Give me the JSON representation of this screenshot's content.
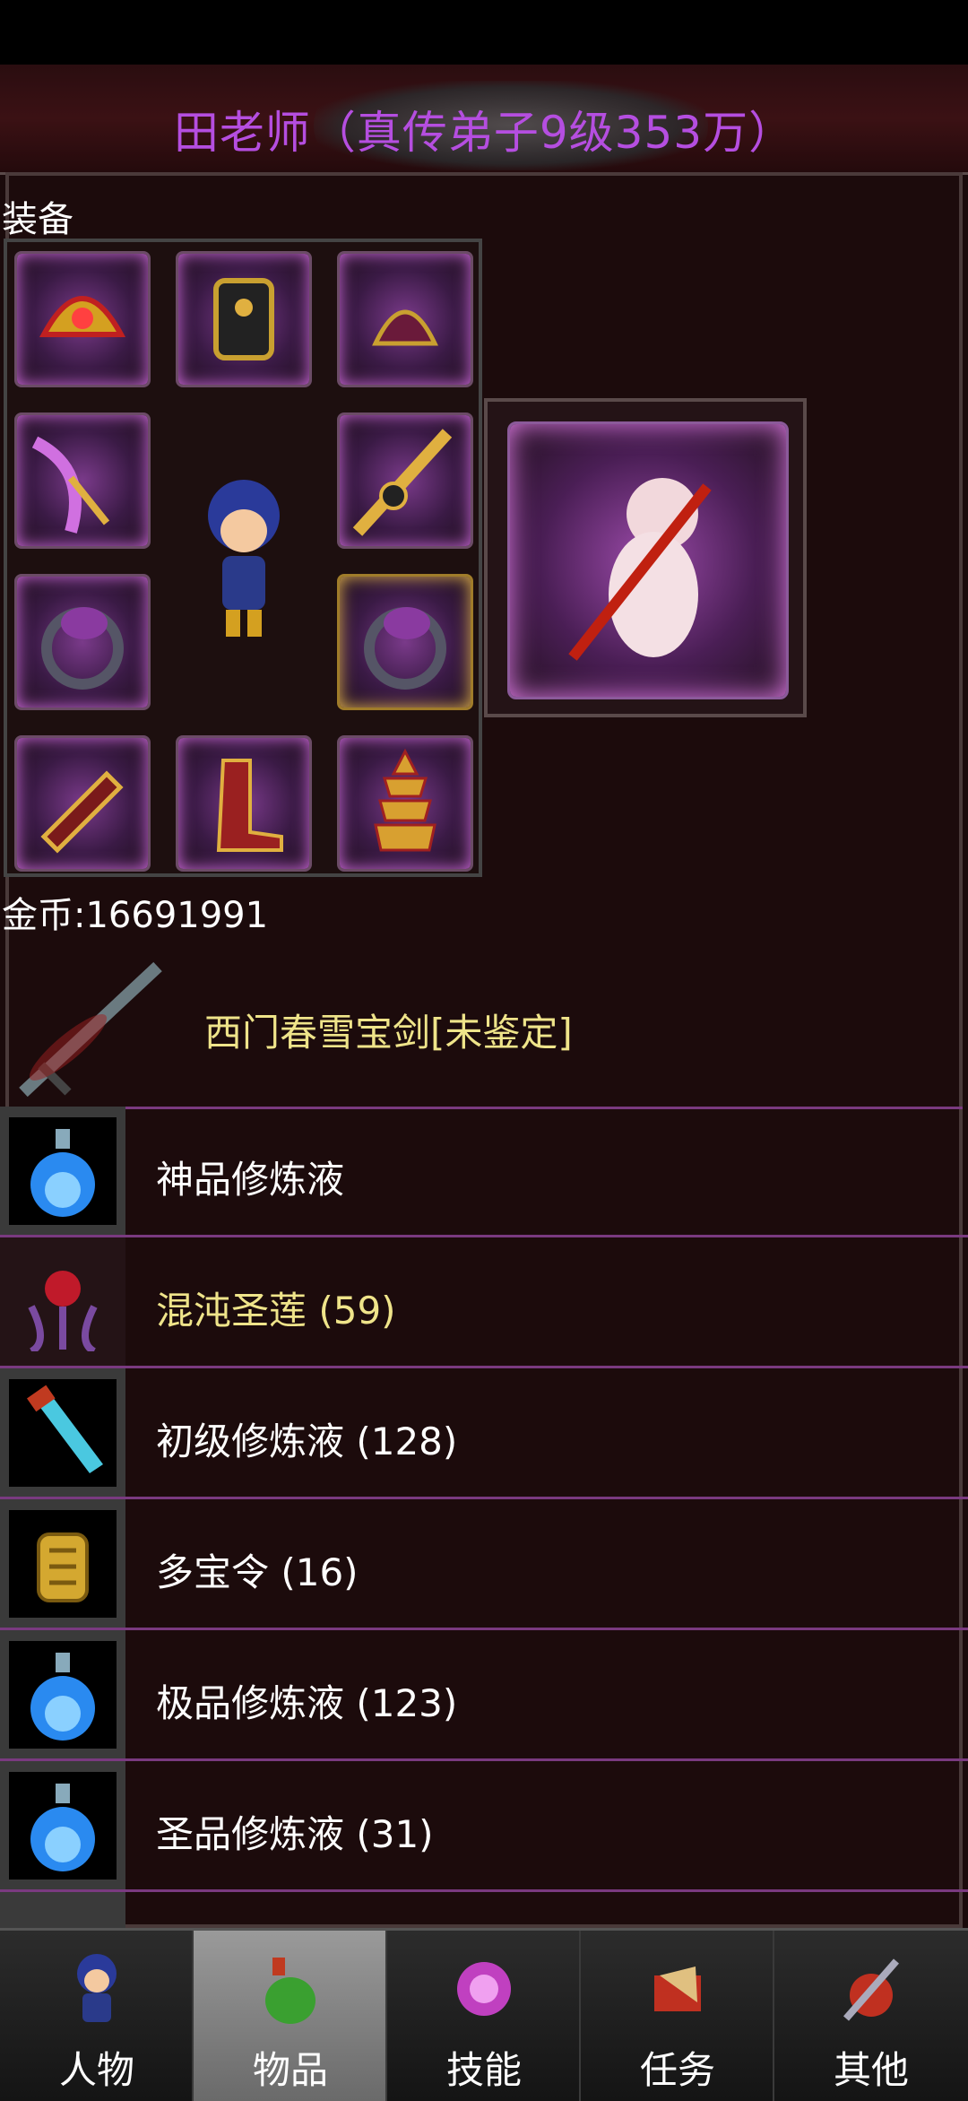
{
  "title": "田老师（真传弟子9级353万）",
  "equipment": {
    "label": "装备"
  },
  "gold": {
    "label": "金币:16691991"
  },
  "featured_item": {
    "name": "西门春雪宝剑[未鉴定]",
    "color": "#efe48a"
  },
  "items": [
    {
      "name": "神品修炼液",
      "icon": "blue-potion-icon",
      "color": "#ffffff"
    },
    {
      "name": "混沌圣莲 (59)",
      "icon": "lotus-icon",
      "color": "#efe48a"
    },
    {
      "name": "初级修炼液 (128)",
      "icon": "vial-icon",
      "color": "#ffffff"
    },
    {
      "name": "多宝令 (16)",
      "icon": "token-icon",
      "color": "#ffffff"
    },
    {
      "name": "极品修炼液 (123)",
      "icon": "blue-potion-icon",
      "color": "#ffffff"
    },
    {
      "name": "圣品修炼液 (31)",
      "icon": "blue-potion-icon",
      "color": "#ffffff"
    }
  ],
  "nav": [
    {
      "label": "人物",
      "icon": "character-icon"
    },
    {
      "label": "物品",
      "icon": "potion-bag-icon",
      "active": true
    },
    {
      "label": "技能",
      "icon": "skill-orb-icon"
    },
    {
      "label": "任务",
      "icon": "quest-scroll-icon"
    },
    {
      "label": "其他",
      "icon": "sword-shield-icon"
    }
  ],
  "colors": {
    "title": "#b54ee0",
    "divider": "#7a3a80",
    "background": "#1a0a0b"
  }
}
